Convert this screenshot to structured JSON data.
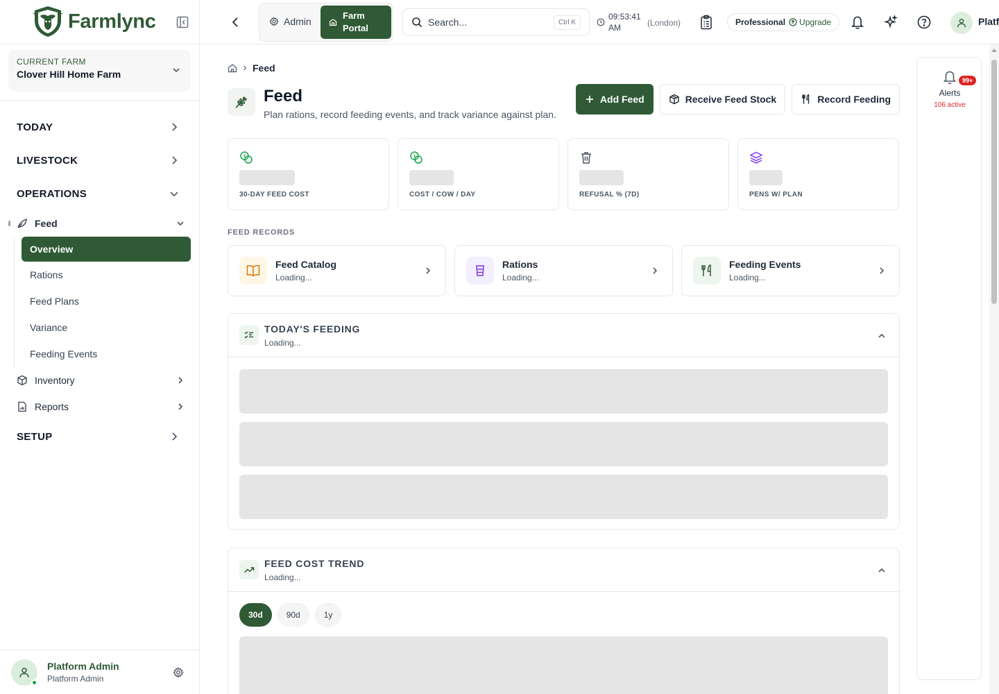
{
  "brand": {
    "name": "Farmlync"
  },
  "farm_selector": {
    "label": "CURRENT FARM",
    "value": "Clover Hill Home Farm"
  },
  "sidebar": {
    "sections": {
      "today": "TODAY",
      "livestock": "LIVESTOCK",
      "operations": "OPERATIONS",
      "setup": "SETUP"
    },
    "feed": {
      "label": "Feed",
      "children": [
        "Overview",
        "Rations",
        "Feed Plans",
        "Variance",
        "Feeding Events"
      ]
    },
    "inventory": "Inventory",
    "reports": "Reports"
  },
  "user": {
    "name": "Platform Admin",
    "role": "Platform Admin"
  },
  "topbar": {
    "admin_label": "Admin",
    "farm_portal_label": "Farm Portal",
    "search_placeholder": "Search...",
    "search_shortcut": "Ctrl K",
    "time": "09:53:41 AM",
    "timezone": "(London)",
    "plan": "Professional",
    "upgrade": "Upgrade",
    "user_short": "Platf"
  },
  "breadcrumb": {
    "current": "Feed"
  },
  "page": {
    "title": "Feed",
    "subtitle": "Plan rations, record feeding events, and track variance against plan.",
    "actions": {
      "add": "Add Feed",
      "receive": "Receive Feed Stock",
      "record": "Record Feeding"
    }
  },
  "stats": [
    {
      "label": "30-DAY FEED COST",
      "icon": "coins-icon"
    },
    {
      "label": "COST / COW / DAY",
      "icon": "coins-icon"
    },
    {
      "label": "REFUSAL % (7D)",
      "icon": "trash-icon"
    },
    {
      "label": "PENS W/ PLAN",
      "icon": "layers-icon"
    }
  ],
  "records": {
    "section_label": "FEED RECORDS",
    "items": [
      {
        "title": "Feed Catalog",
        "status": "Loading..."
      },
      {
        "title": "Rations",
        "status": "Loading..."
      },
      {
        "title": "Feeding Events",
        "status": "Loading..."
      }
    ]
  },
  "todays_feeding": {
    "title": "TODAY'S FEEDING",
    "status": "Loading..."
  },
  "cost_trend": {
    "title": "FEED COST TREND",
    "status": "Loading...",
    "ranges": [
      "30d",
      "90d",
      "1y"
    ],
    "selected_range": "30d"
  },
  "alerts": {
    "badge": "99+",
    "label": "Alerts",
    "count_text": "106 active"
  },
  "colors": {
    "brand": "#2f5a35",
    "alert": "#dc2626",
    "skeleton": "#e5e5e5"
  }
}
